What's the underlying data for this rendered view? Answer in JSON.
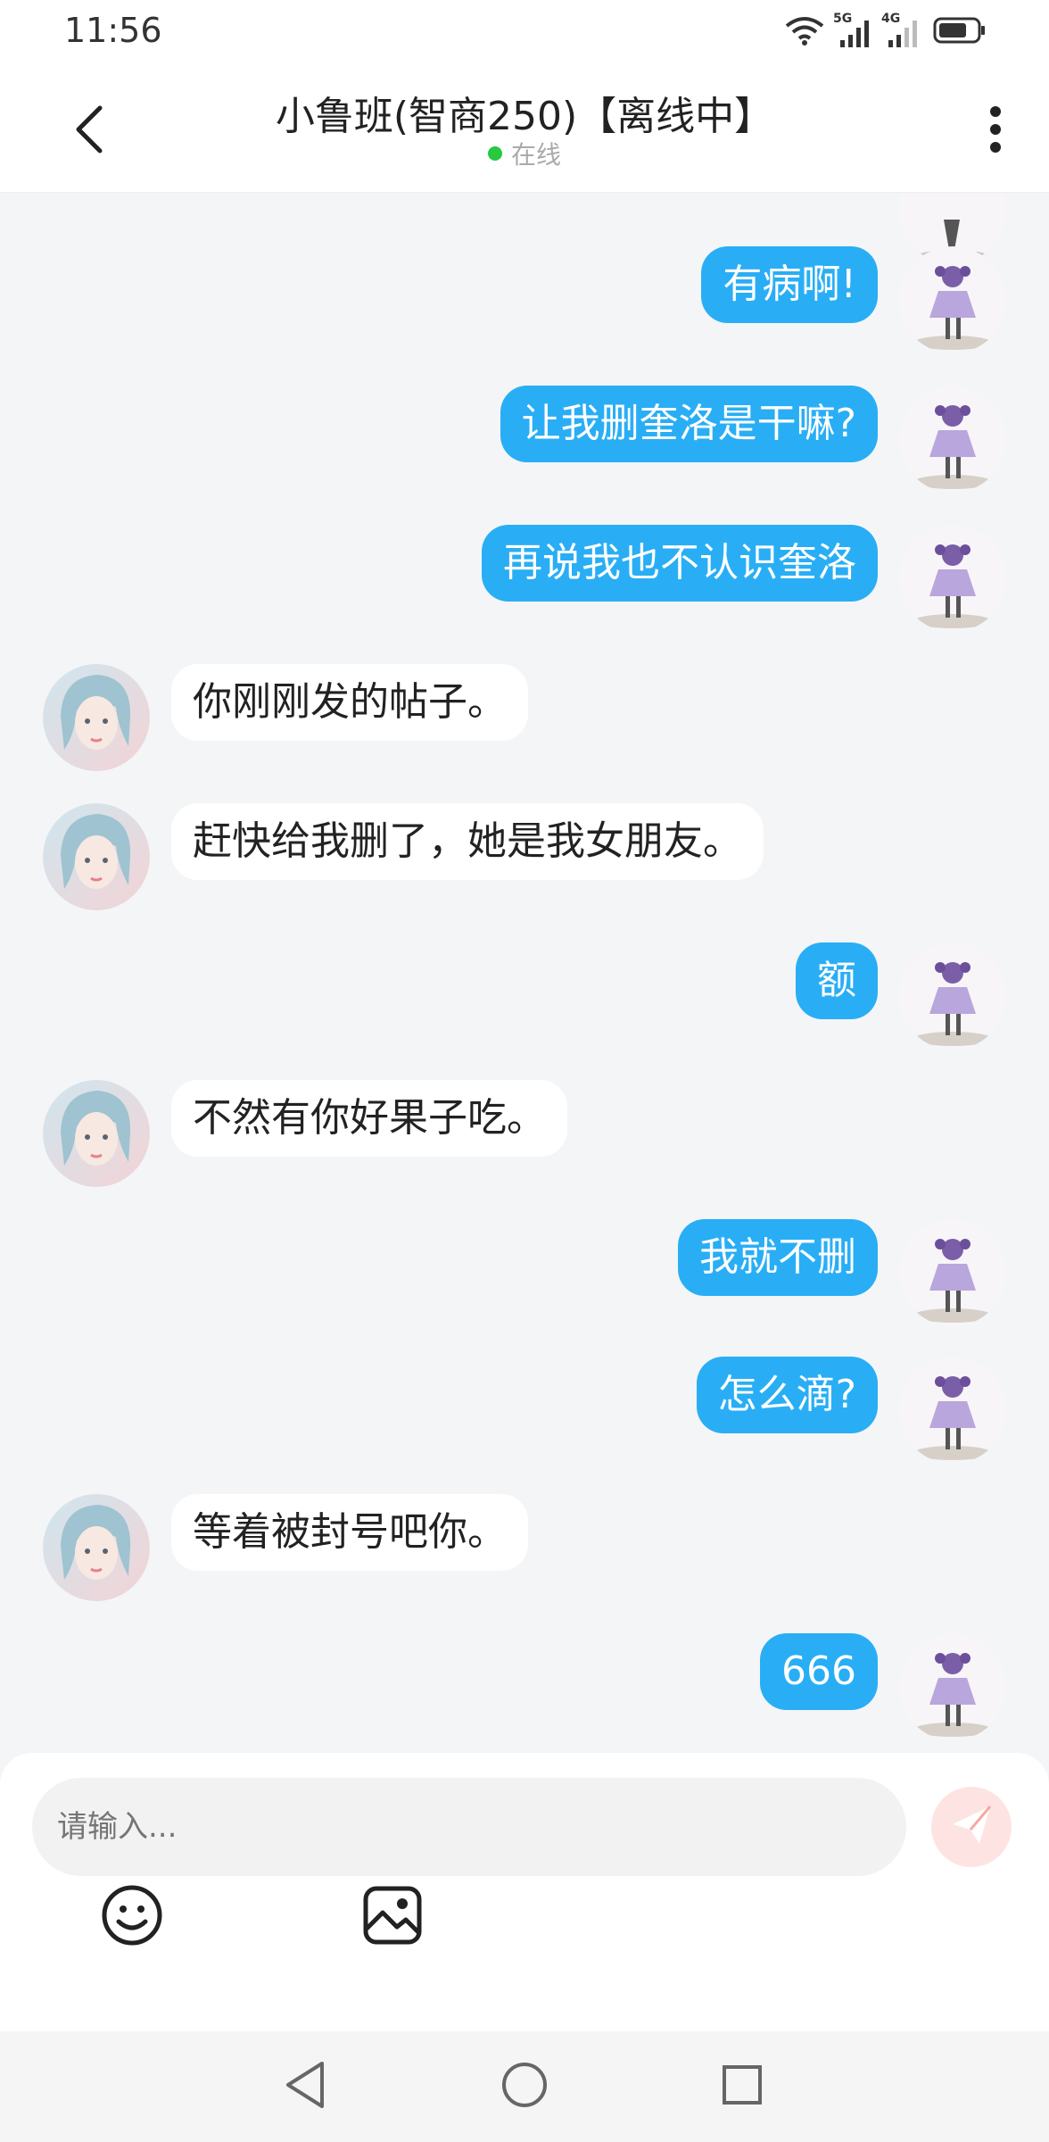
{
  "status_bar": {
    "time": "11:56",
    "signal1_label": "5G",
    "signal2_label": "4G"
  },
  "header": {
    "title": "小鲁班(智商250)【离线中】",
    "status": "在线"
  },
  "messages": [
    {
      "side": "right",
      "text": "有病啊!"
    },
    {
      "side": "right",
      "text": "让我删奎洛是干嘛?"
    },
    {
      "side": "right",
      "text": "再说我也不认识奎洛"
    },
    {
      "side": "left",
      "text": "你刚刚发的帖子。"
    },
    {
      "side": "left",
      "text": "赶快给我删了，她是我女朋友。"
    },
    {
      "side": "right",
      "text": "额"
    },
    {
      "side": "left",
      "text": "不然有你好果子吃。"
    },
    {
      "side": "right",
      "text": "我就不删"
    },
    {
      "side": "right",
      "text": "怎么滴?"
    },
    {
      "side": "left",
      "text": "等着被封号吧你。"
    },
    {
      "side": "right",
      "text": "666"
    }
  ],
  "composer": {
    "placeholder": "请输入..."
  },
  "colors": {
    "bubble_self": "#29aef5",
    "bubble_other": "#ffffff",
    "online": "#27c93f",
    "send": "#f7a8a0"
  },
  "icons": [
    "back-arrow-icon",
    "more-vertical-icon",
    "emoji-icon",
    "image-icon",
    "send-icon",
    "nav-back-icon",
    "nav-home-icon",
    "nav-recents-icon"
  ]
}
